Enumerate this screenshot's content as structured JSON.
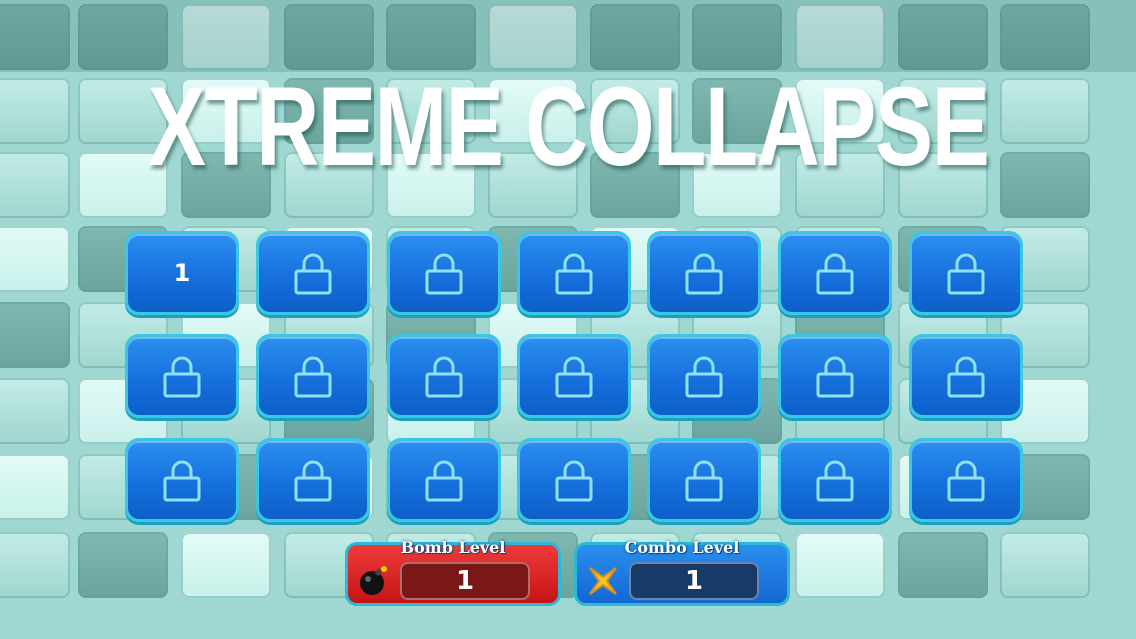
{
  "title": "XTREME COLLAPSE",
  "levels": [
    {
      "label": "1",
      "locked": false
    },
    {
      "label": "",
      "locked": true
    },
    {
      "label": "",
      "locked": true
    },
    {
      "label": "",
      "locked": true
    },
    {
      "label": "",
      "locked": true
    },
    {
      "label": "",
      "locked": true
    },
    {
      "label": "",
      "locked": true
    },
    {
      "label": "",
      "locked": true
    },
    {
      "label": "",
      "locked": true
    },
    {
      "label": "",
      "locked": true
    },
    {
      "label": "",
      "locked": true
    },
    {
      "label": "",
      "locked": true
    },
    {
      "label": "",
      "locked": true
    },
    {
      "label": "",
      "locked": true
    },
    {
      "label": "",
      "locked": true
    },
    {
      "label": "",
      "locked": true
    },
    {
      "label": "",
      "locked": true
    },
    {
      "label": "",
      "locked": true
    },
    {
      "label": "",
      "locked": true
    },
    {
      "label": "",
      "locked": true
    },
    {
      "label": "",
      "locked": true
    }
  ],
  "level_icon_locked": "lock-icon",
  "bomb": {
    "label": "Bomb Level",
    "value": "1",
    "icon": "bomb-icon",
    "color": "#e02020"
  },
  "combo": {
    "label": "Combo Level",
    "value": "1",
    "icon": "cross-icon",
    "color": "#1f7be6"
  },
  "colors": {
    "background": "#9fd8d2",
    "button": "#1670dd",
    "button_border": "#39c7e3"
  }
}
